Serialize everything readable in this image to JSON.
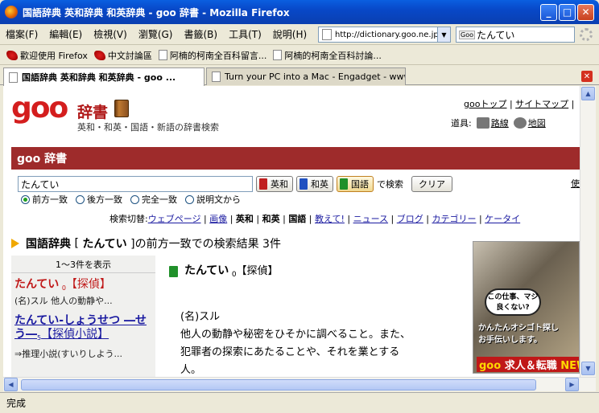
{
  "window": {
    "title": "国語辞典 英和辞典 和英辞典 - goo 辞書 - Mozilla Firefox"
  },
  "menu": [
    "檔案(F)",
    "編輯(E)",
    "檢視(V)",
    "瀏覽(G)",
    "書籤(B)",
    "工具(T)",
    "說明(H)"
  ],
  "toolbar": {
    "url": "http://dictionary.goo.ne.jp/",
    "search_value": "たんてい",
    "search_engine": "Goo"
  },
  "bookmarks": [
    "歡迎使用 Firefox",
    "中文討論區",
    "阿楠的柯南全百科留言...",
    "阿楠的柯南全百科討論..."
  ],
  "tabs": [
    {
      "label": "国語辞典 英和辞典 和英辞典 - goo ..."
    },
    {
      "label": "Turn your PC into a Mac - Engadget - www.e..."
    }
  ],
  "page": {
    "logo": "goo",
    "dict_title": "辞書",
    "tagline": "英和・和英・国語・新語の辞書検索",
    "toplinks": [
      "gooトップ",
      "サイトマップ"
    ],
    "tools_label": "道具:",
    "tools": [
      "路線",
      "地図"
    ],
    "banner_title": "goo 辞書",
    "query": "たんてい",
    "dict_buttons": [
      "英和",
      "和英",
      "国語"
    ],
    "search_label": "で検索",
    "clear_label": "クリア",
    "use_label": "使",
    "match_options": [
      "前方一致",
      "後方一致",
      "完全一致",
      "説明文から"
    ],
    "switch_label": "検索切替:",
    "switch_links": [
      "ウェブページ",
      "画像"
    ],
    "switch_plain": [
      "英和",
      "和英",
      "国語"
    ],
    "switch_links2": [
      "教えて!",
      "ニュース",
      "ブログ",
      "カテゴリー",
      "ケータイ"
    ],
    "result_heading": {
      "dict": "国語辞典",
      "query": "たんてい",
      "rest": "]の前方一致での検索結果 3件"
    },
    "sidebar": {
      "count": "1～3件を表示",
      "items": [
        {
          "term": "たんてい",
          "sub": "0",
          "kanji": "【探偵】",
          "desc": "(名)スル 他人の動静や..."
        },
        {
          "term": "たんてい-しょうせつ ―せう―",
          "sub": "5",
          "kanji": "【探偵小説】",
          "desc": "⇒推理小説(すいりしよう..."
        }
      ]
    },
    "entry": {
      "headword": "たんてい",
      "sub": "0",
      "kanji": "【探偵】"
    },
    "definition": {
      "pos": "(名)スル",
      "lines": [
        "他人の動静や秘密をひそかに調べること。また、",
        "犯罪者の探索にあたることや、それを業とする",
        "人。"
      ]
    },
    "ad": {
      "bubble": "この仕事、マジ良くない?",
      "line1": "かんたんオシゴト探し",
      "line2": "お手伝いします。",
      "brand": "goo",
      "brand_tail": "求人＆転職",
      "brand_new": "NEW"
    }
  },
  "status": "完成"
}
